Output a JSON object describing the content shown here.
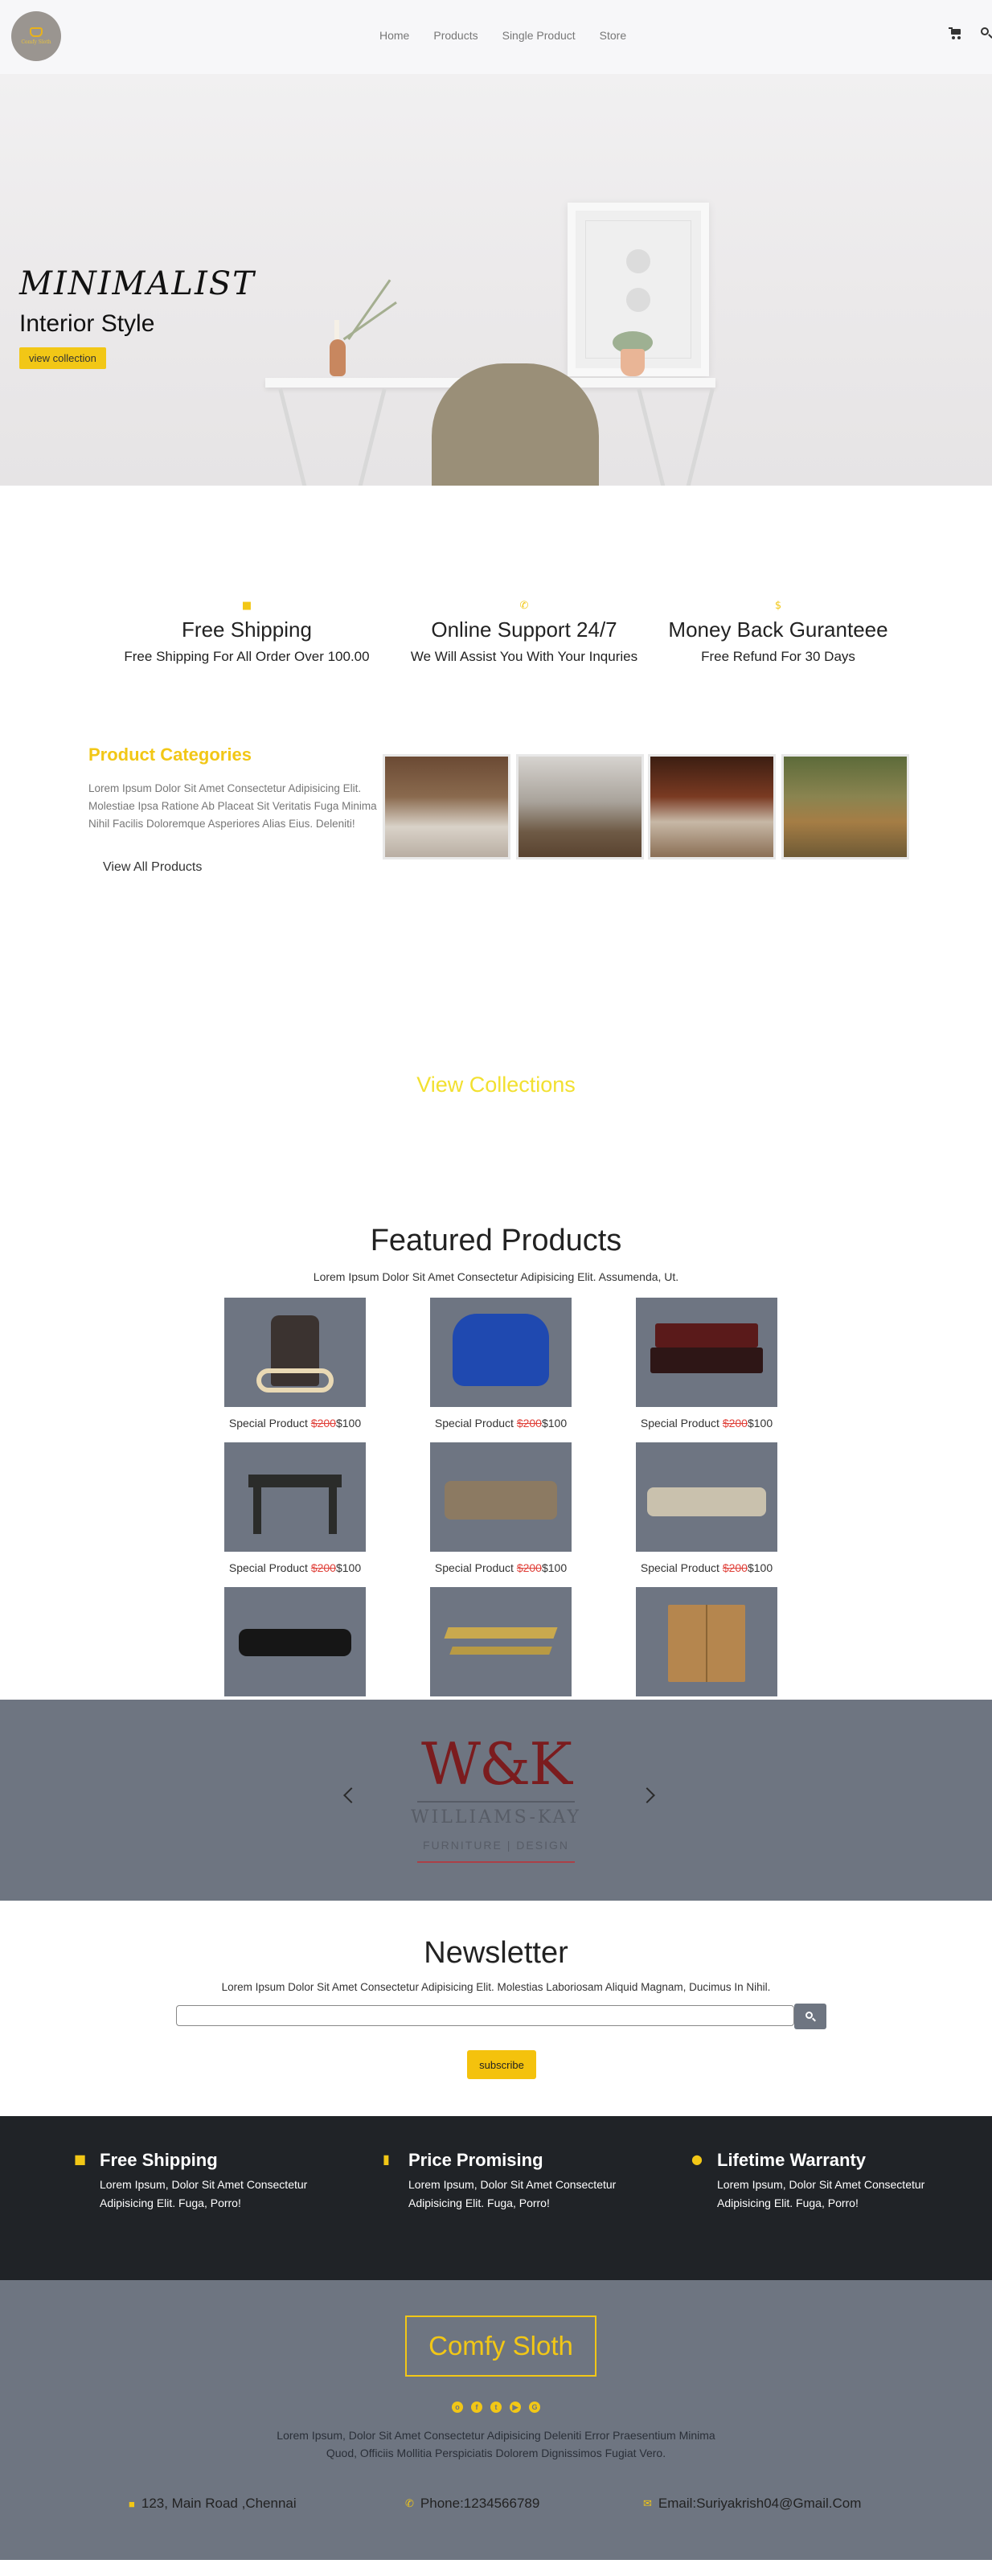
{
  "nav": {
    "logo_text": "Comfy Sloth",
    "links": [
      "Home",
      "Products",
      "Single Product",
      "Store"
    ],
    "cart_icon": "cart-icon",
    "search_icon": "search-icon"
  },
  "hero": {
    "title": "MINIMALIST",
    "subtitle": "Interior Style",
    "button": "view collection"
  },
  "services": [
    {
      "icon": "truck-icon",
      "title": "Free Shipping",
      "desc": "Free Shipping For All Order Over 100.00"
    },
    {
      "icon": "phone-icon",
      "title": "Online Support 24/7",
      "desc": "We Will Assist You With Your Inquries"
    },
    {
      "icon": "dollar-icon",
      "title": "Money Back Guranteee",
      "desc": "Free Refund For 30 Days"
    }
  ],
  "categories": {
    "title": "Product Categories",
    "desc": "Lorem Ipsum Dolor Sit Amet Consectetur Adipisicing Elit. Molestiae Ipsa Ratione Ab Placeat Sit Veritatis Fuga Minima Nihil Facilis Doloremque Asperiores Alias Eius. Deleniti!",
    "link": "View All Products"
  },
  "view_collections": "View Collections",
  "featured": {
    "title": "Featured Products",
    "subtitle": "Lorem Ipsum Dolor Sit Amet Consectetur Adipisicing Elit. Assumenda, Ut.",
    "product_label": "Special Product",
    "old_price": "$200",
    "new_price": "$100"
  },
  "brand": {
    "mark": "W&K",
    "name": "WILLIAMS-KAY",
    "sub": "FURNITURE | DESIGN"
  },
  "newsletter": {
    "title": "Newsletter",
    "subtitle": "Lorem Ipsum Dolor Sit Amet Consectetur Adipisicing Elit. Molestias Laboriosam Aliquid Magnam, Ducimus In Nihil.",
    "placeholder": "",
    "button": "subscribe"
  },
  "perks": [
    {
      "icon": "truck-icon",
      "title": "Free Shipping",
      "desc": "Lorem Ipsum, Dolor Sit Amet Consectetur Adipisicing Elit. Fuga, Porro!"
    },
    {
      "icon": "chat-icon",
      "title": "Price Promising",
      "desc": "Lorem Ipsum, Dolor Sit Amet Consectetur Adipisicing Elit. Fuga, Porro!"
    },
    {
      "icon": "award-icon",
      "title": "Lifetime Warranty",
      "desc": "Lorem Ipsum, Dolor Sit Amet Consectetur Adipisicing Elit. Fuga, Porro!"
    }
  ],
  "footer": {
    "brand": "Comfy Sloth",
    "desc": "Lorem Ipsum, Dolor Sit Amet Consectetur Adipisicing Deleniti Error Praesentium Minima Quod, Officiis Mollitia Perspiciatis Dolorem Dignissimos Fugiat Vero.",
    "address": "123, Main Road ,Chennai",
    "phone": "Phone:1234566789",
    "email": "Email:Suriyakrish04@Gmail.Com"
  },
  "colors": {
    "accent": "#f2c716",
    "slate": "#6e7581",
    "dark": "#202327"
  }
}
